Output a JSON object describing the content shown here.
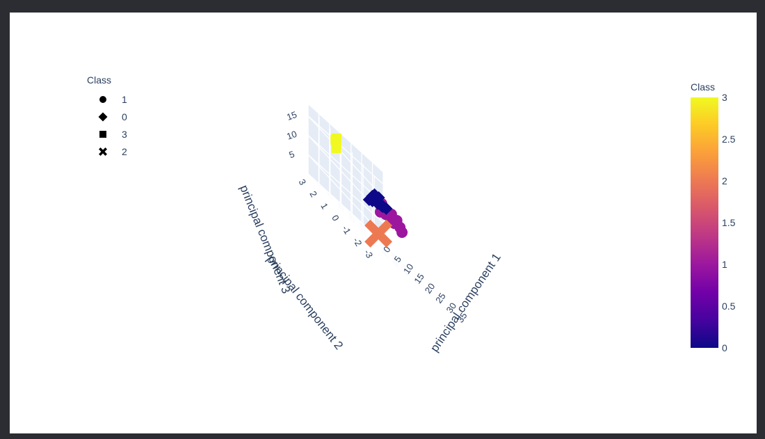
{
  "chart_data": {
    "type": "scatter3d",
    "axes": {
      "x": {
        "label": "principal component 1",
        "ticks": [
          "0",
          "5",
          "10",
          "15",
          "20",
          "25",
          "30",
          "35"
        ]
      },
      "y": {
        "label": "principal component 2",
        "ticks": [
          "3",
          "2",
          "1",
          "0",
          "-1",
          "-2",
          "-3"
        ]
      },
      "z": {
        "label": "principal component 3",
        "ticks": [
          "5",
          "10",
          "15"
        ]
      }
    },
    "legend": {
      "title": "Class",
      "placement": "top-left",
      "items": [
        {
          "label": "1",
          "symbol": "circle"
        },
        {
          "label": "0",
          "symbol": "diamond"
        },
        {
          "label": "3",
          "symbol": "square"
        },
        {
          "label": "2",
          "symbol": "x"
        }
      ]
    },
    "colorbar": {
      "title": "Class",
      "range": [
        0,
        3
      ],
      "ticks": [
        "3",
        "2.5",
        "2",
        "1.5",
        "1",
        "0.5",
        "0"
      ],
      "colors": [
        "#0d0887",
        "#46039f",
        "#7201a8",
        "#9c179e",
        "#bd3786",
        "#d8576b",
        "#ed7953",
        "#fb9f3a",
        "#fdca26",
        "#f0f921"
      ]
    },
    "series": [
      {
        "name": "1",
        "symbol": "circle",
        "color": "#9c179e",
        "points": [
          [
            24,
            0.6,
            9
          ],
          [
            25,
            0.8,
            9.5
          ],
          [
            26,
            0.5,
            8.5
          ],
          [
            27,
            0.9,
            9.2
          ],
          [
            23,
            0.4,
            10
          ],
          [
            25,
            0.3,
            10.5
          ],
          [
            26,
            1.0,
            8.8
          ],
          [
            28,
            0.7,
            9
          ],
          [
            24,
            1.1,
            8.2
          ],
          [
            27,
            0.2,
            10.2
          ],
          [
            29,
            0.8,
            8.6
          ],
          [
            25,
            1.3,
            8
          ],
          [
            22,
            0.6,
            10.8
          ],
          [
            30,
            0.5,
            9
          ],
          [
            33,
            0.9,
            8
          ]
        ]
      },
      {
        "name": "0",
        "symbol": "diamond",
        "color": "#0d0887",
        "points": [
          [
            12,
            -0.5,
            10
          ],
          [
            13,
            -0.3,
            11
          ],
          [
            14,
            -0.6,
            10.5
          ],
          [
            15,
            -0.2,
            11.5
          ],
          [
            16,
            -0.4,
            11
          ],
          [
            11,
            -0.7,
            10
          ],
          [
            17,
            -0.1,
            12
          ],
          [
            13,
            -0.5,
            12
          ],
          [
            18,
            -0.3,
            10.8
          ],
          [
            14,
            -0.8,
            11.2
          ],
          [
            19,
            0.0,
            10.5
          ],
          [
            20,
            -0.2,
            11
          ],
          [
            10,
            -0.6,
            9.5
          ]
        ]
      },
      {
        "name": "3",
        "symbol": "square",
        "color": "#f0f921",
        "points": [
          [
            5,
            1.5,
            16
          ],
          [
            2,
            0.8,
            17
          ],
          [
            3,
            1.0,
            15.5
          ],
          [
            6,
            1.6,
            14
          ]
        ]
      },
      {
        "name": "2",
        "symbol": "x",
        "color": "#ed7953",
        "points": [
          [
            3,
            -2.8,
            4
          ]
        ]
      }
    ]
  }
}
